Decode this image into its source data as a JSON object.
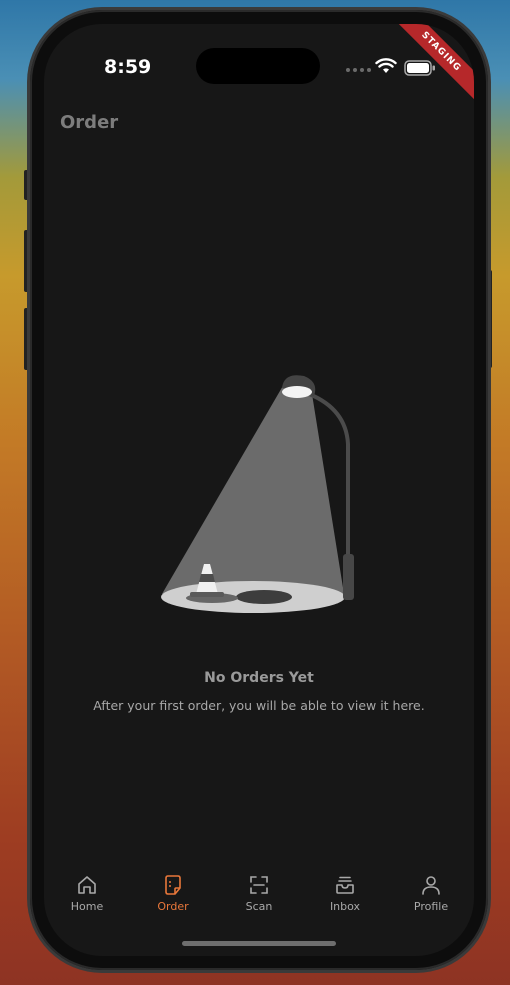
{
  "status": {
    "time": "8:59"
  },
  "ribbon": {
    "label": "STAGING"
  },
  "header": {
    "title": "Order"
  },
  "empty_state": {
    "title": "No Orders Yet",
    "subtitle": "After your first order, you will be able to view it here."
  },
  "tabs": [
    {
      "label": "Home",
      "icon": "home-icon"
    },
    {
      "label": "Order",
      "icon": "order-icon",
      "active": true
    },
    {
      "label": "Scan",
      "icon": "scan-icon"
    },
    {
      "label": "Inbox",
      "icon": "inbox-icon"
    },
    {
      "label": "Profile",
      "icon": "profile-icon"
    }
  ],
  "colors": {
    "accent": "#e8773a",
    "background": "#171717",
    "ribbon": "#b6282a"
  }
}
